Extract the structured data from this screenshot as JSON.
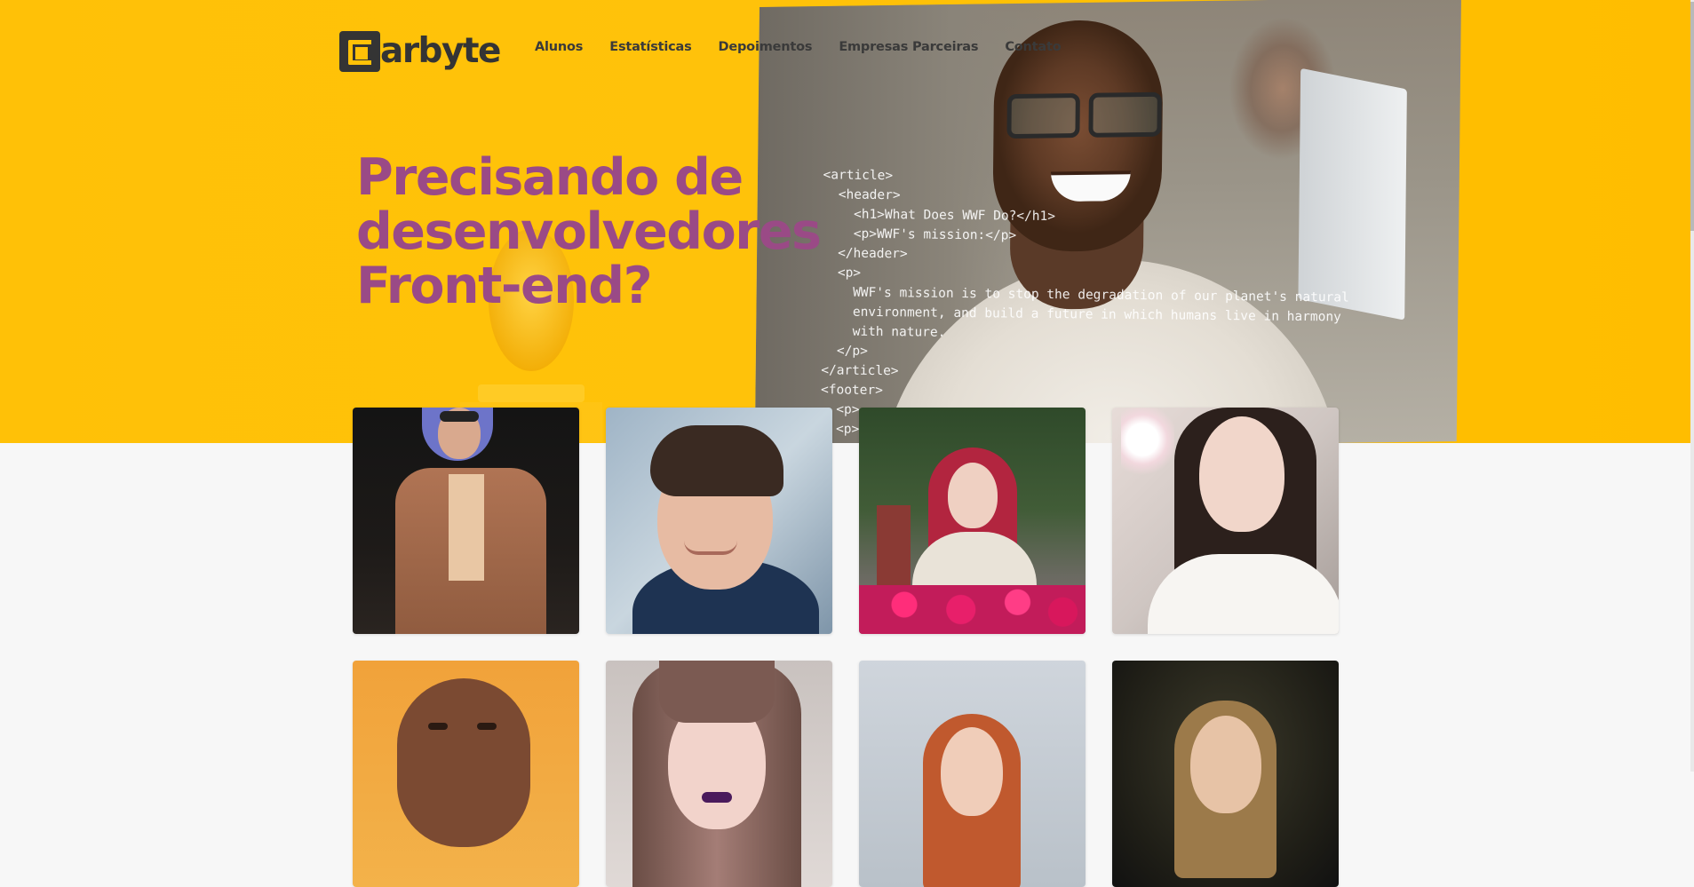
{
  "brand": {
    "name": "arbyte",
    "primary_color": "#ffc107",
    "headline_color": "#9a4a86",
    "dark_color": "#343434"
  },
  "nav": {
    "items": [
      "Alunos",
      "Estatísticas",
      "Depoimentos",
      "Empresas Parceiras",
      "Contato"
    ]
  },
  "hero": {
    "headline_lines": [
      "Precisando de",
      "desenvolvedores",
      "Front-end?"
    ],
    "code_lines": [
      "<article>",
      "  <header>",
      "    <h1>What Does WWF Do?</h1>",
      "    <p>WWF's mission:</p>",
      "  </header>",
      "  <p>",
      "    WWF's mission is to stop the degradation of our planet's natural",
      "    environment, and build a future in which humans live in harmony",
      "    with nature.",
      "  </p>",
      "</article>",
      "<footer>",
      "  <p>",
      "  <p>C"
    ]
  },
  "gallery": {
    "tiles": [
      "student-photo-purple-hair-coat",
      "student-photo-young-man-smiling",
      "student-photo-red-hair-flowers",
      "student-photo-dark-hair-woman",
      "student-photo-shaved-head-woman",
      "student-photo-bangs-purple-lips",
      "student-photo-ginger-woman",
      "student-photo-blonde-girl-dark-bg"
    ]
  }
}
